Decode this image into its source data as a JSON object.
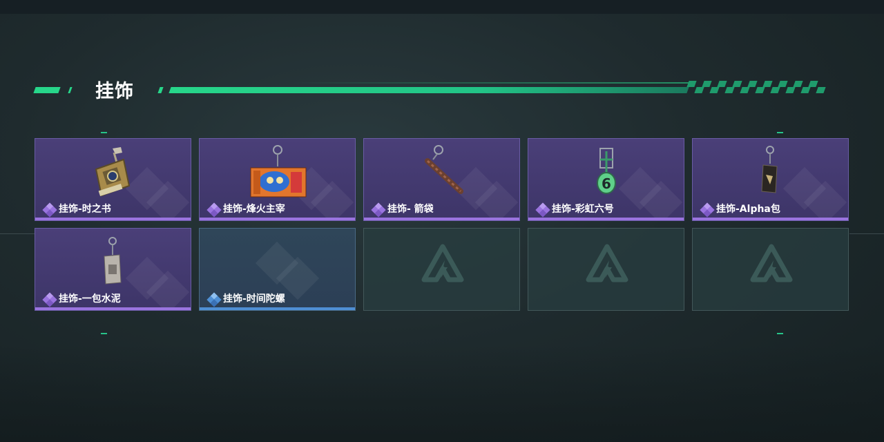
{
  "section": {
    "title": "挂饰"
  },
  "colors": {
    "accent": "#27d68a",
    "purple_rarity": "#9a74df",
    "blue_rarity": "#4f8fd4"
  },
  "items": [
    {
      "name": "挂饰-时之书",
      "rarity": "purple",
      "icon": "book-charm-icon"
    },
    {
      "name": "挂饰-烽火主宰",
      "rarity": "purple",
      "icon": "graffiti-tag-charm-icon"
    },
    {
      "name": "挂饰- 箭袋",
      "rarity": "purple",
      "icon": "quiver-charm-icon"
    },
    {
      "name": "挂饰-彩虹六号",
      "rarity": "purple",
      "icon": "rainbow-six-charm-icon"
    },
    {
      "name": "挂饰-Alpha包",
      "rarity": "purple",
      "icon": "alpha-pack-charm-icon"
    },
    {
      "name": "挂饰-一包水泥",
      "rarity": "purple",
      "icon": "cement-bag-charm-icon"
    },
    {
      "name": "挂饰-时间陀螺",
      "rarity": "blue",
      "icon": "time-gyro-charm-icon"
    }
  ],
  "empty_slots": [
    {
      "icon": "game-logo-icon"
    },
    {
      "icon": "game-logo-icon"
    },
    {
      "icon": "game-logo-icon"
    }
  ]
}
